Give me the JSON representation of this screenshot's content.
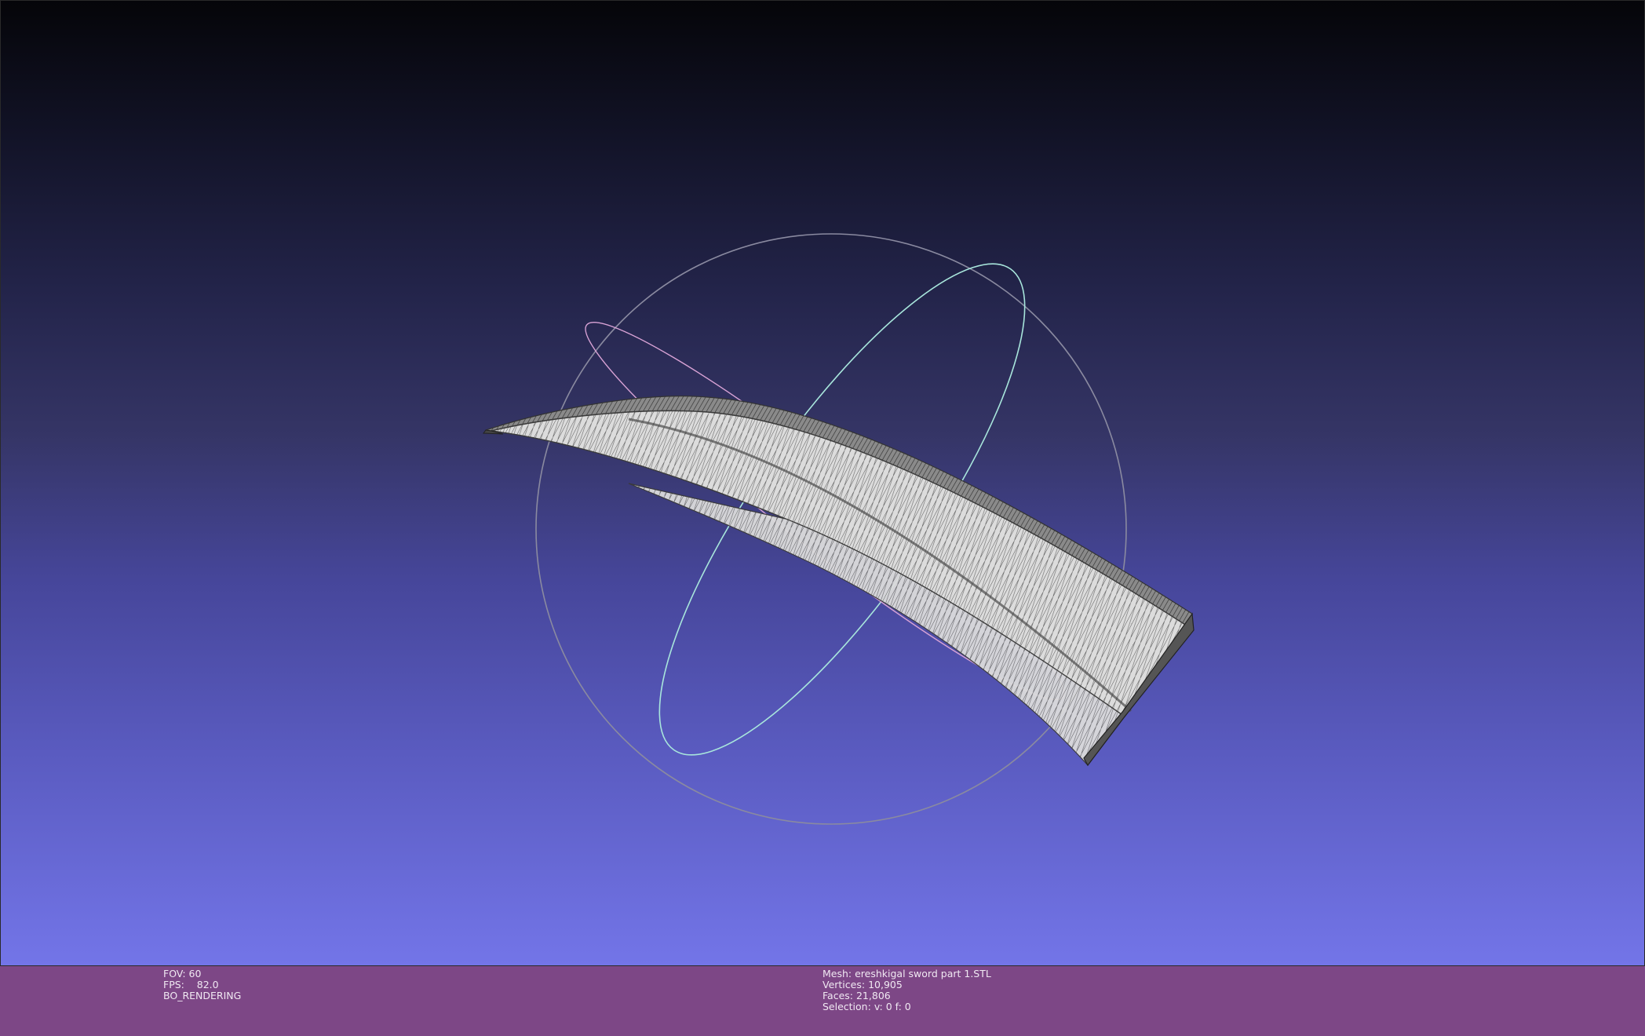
{
  "render_info": {
    "fov_label": "FOV:",
    "fov_value": "60",
    "fps_label": "FPS:",
    "fps_value": "82.0",
    "mode": "BO_RENDERING"
  },
  "mesh_info": {
    "mesh_label": "Mesh:",
    "mesh_name": "ereshkigal sword part 1.STL",
    "vertices_label": "Vertices:",
    "vertices_value": "10,905",
    "faces_label": "Faces:",
    "faces_value": "21,806",
    "selection_label": "Selection:",
    "selection_value": "v: 0 f: 0"
  },
  "colors": {
    "status_bar": "#7d4786",
    "trackball_circle_gray": "#8a8aa0",
    "trackball_circle_cyan": "#a8e6dc",
    "trackball_circle_pink": "#d9a3d6",
    "mesh_fill": "#d8d8d8",
    "mesh_edges": "#3a3a3a"
  }
}
